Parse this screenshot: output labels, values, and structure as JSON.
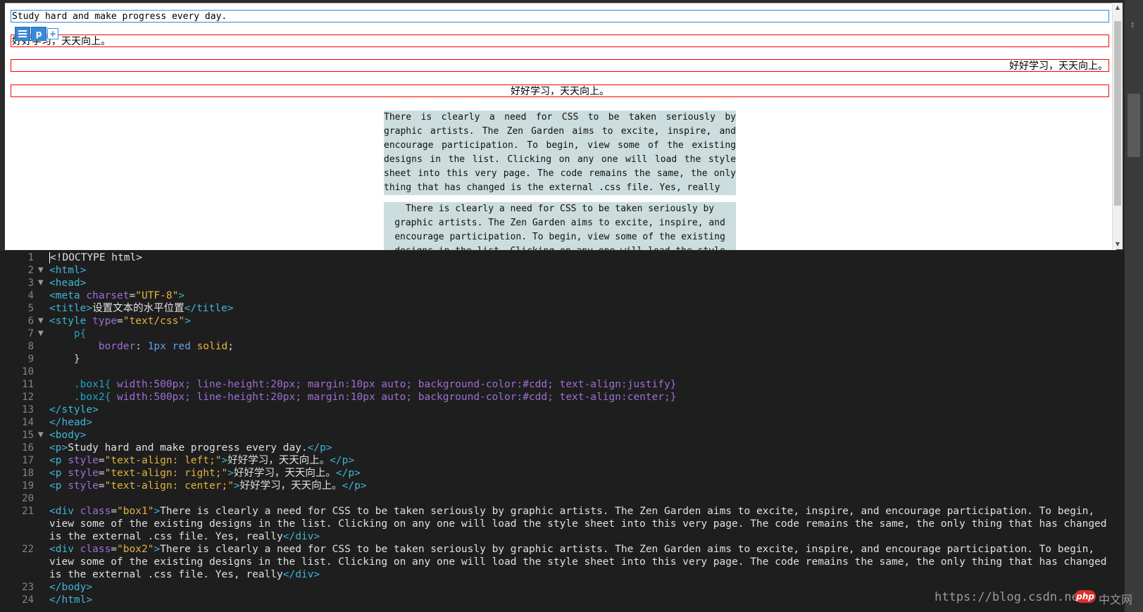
{
  "preview": {
    "line1": "Study hard and make progress every day.",
    "line2": "好好学习，天天向上。",
    "line3": "好好学习，天天向上。",
    "line4": "好好学习，天天向上。",
    "box1": "There is clearly a need for CSS to be taken seriously by graphic artists. The Zen Garden aims to excite, inspire, and encourage participation. To begin, view some of the existing designs in the list. Clicking on any one will load the style sheet into this very page. The code remains the same, the only thing that has changed is the external .css file. Yes, really",
    "box2": "There is clearly a need for CSS to be taken seriously by graphic artists. The Zen Garden aims to excite, inspire, and encourage participation. To begin, view some of the existing designs in the list. Clicking on any one will load the style sheet into this very page. The code remains the same, the only thing that has changed is the external .css file. Yes, really",
    "toolbar": {
      "menu_icon": "menu-icon",
      "tag_label": "p",
      "add_label": "+"
    },
    "scroll_up": "▲",
    "scroll_down": "▼"
  },
  "editor": {
    "line_numbers": [
      "1",
      "2",
      "3",
      "4",
      "5",
      "6",
      "7",
      "8",
      "9",
      "10",
      "11",
      "12",
      "13",
      "14",
      "15",
      "16",
      "17",
      "18",
      "19",
      "20",
      "21",
      "22",
      "23",
      "24"
    ],
    "fold_marker": "▼",
    "lines": {
      "l1": "<!DOCTYPE html>",
      "l2": "<html>",
      "l3": "<head>",
      "l4_tag": "<meta",
      "l4_attr": "charset",
      "l4_val": "\"UTF-8\"",
      "l4_end": ">",
      "l5_open": "<title>",
      "l5_text": "设置文本的水平位置",
      "l5_close": "</title>",
      "l6_tag": "<style",
      "l6_attr": "type",
      "l6_val": "\"text/css\"",
      "l6_end": ">",
      "l7": "p{",
      "l8_prop": "border",
      "l8_num": "1px",
      "l8_kw1": "red",
      "l8_kw2": "solid",
      "l9": "}",
      "l11_sel": ".box1{",
      "l11_rest": "width:500px; line-height:20px; margin:10px auto; background-color:#cdd; text-align:justify}",
      "l12_sel": ".box2{",
      "l12_rest": "width:500px; line-height:20px; margin:10px auto; background-color:#cdd; text-align:center;}",
      "l13": "</style>",
      "l14": "</head>",
      "l15": "<body>",
      "l16_open": "<p>",
      "l16_text": "Study hard and make progress every day.",
      "l16_close": "</p>",
      "l17_tag": "<p",
      "l17_attr": "style",
      "l17_val": "\"text-align: left;\"",
      "l17_text": "好好学习，天天向上。",
      "l17_close": "</p>",
      "l18_tag": "<p",
      "l18_attr": "style",
      "l18_val": "\"text-align: right;\"",
      "l18_text": "好好学习，天天向上。",
      "l18_close": "</p>",
      "l19_tag": "<p",
      "l19_attr": "style",
      "l19_val": "\"text-align: center;\"",
      "l19_text": "好好学习，天天向上。",
      "l19_close": "</p>",
      "l21_tag": "<div",
      "l21_attr": "class",
      "l21_val": "\"box1\"",
      "l21_text": "There is clearly a need for CSS to be taken seriously by graphic artists. The Zen Garden aims to excite, inspire, and encourage participation. To begin, view some of the existing designs in the list. Clicking on any one will load the style sheet into this very page. The code remains the same, the only thing that has changed is the external .css file. Yes, really",
      "l21_close": "</div>",
      "l22_tag": "<div",
      "l22_attr": "class",
      "l22_val": "\"box2\"",
      "l22_text": "There is clearly a need for CSS to be taken seriously by graphic artists. The Zen Garden aims to excite, inspire, and encourage participation. To begin, view some of the existing designs in the list. Clicking on any one will load the style sheet into this very page. The code remains the same, the only thing that has changed is the external .css file. Yes, really",
      "l22_close": "</div>",
      "l23": "</body>",
      "l24": "</html>"
    }
  },
  "watermark": {
    "url": "https://blog.csdn.ne",
    "logo": "php",
    "cn": "中文网"
  },
  "colors": {
    "tag": "#3fb5d6",
    "attr": "#9e6ed6",
    "value": "#e3b341",
    "editor_bg": "#1e1e1e",
    "box_bg": "#ccdddd",
    "border_red": "#ff0000"
  }
}
